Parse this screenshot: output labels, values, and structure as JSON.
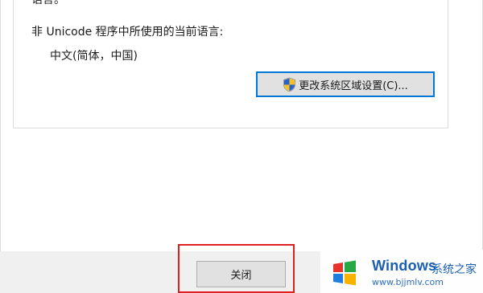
{
  "top_text_cut": "语言。",
  "language_section": {
    "label": "非 Unicode 程序中所使用的当前语言:",
    "value": "中文(简体，中国)",
    "change_button_label": "更改系统区域设置(C)...",
    "change_button_icon": "uac-shield-icon"
  },
  "footer": {
    "close_label": "关闭"
  },
  "watermark": {
    "brand": "Windows",
    "subtitle": "系统之家",
    "url": "www.bjjmlv.com",
    "logo_icon": "windows-logo-icon"
  },
  "colors": {
    "highlight": "#e02020",
    "focus_border": "#0078d7",
    "brand_blue": "#1a5fb4"
  }
}
